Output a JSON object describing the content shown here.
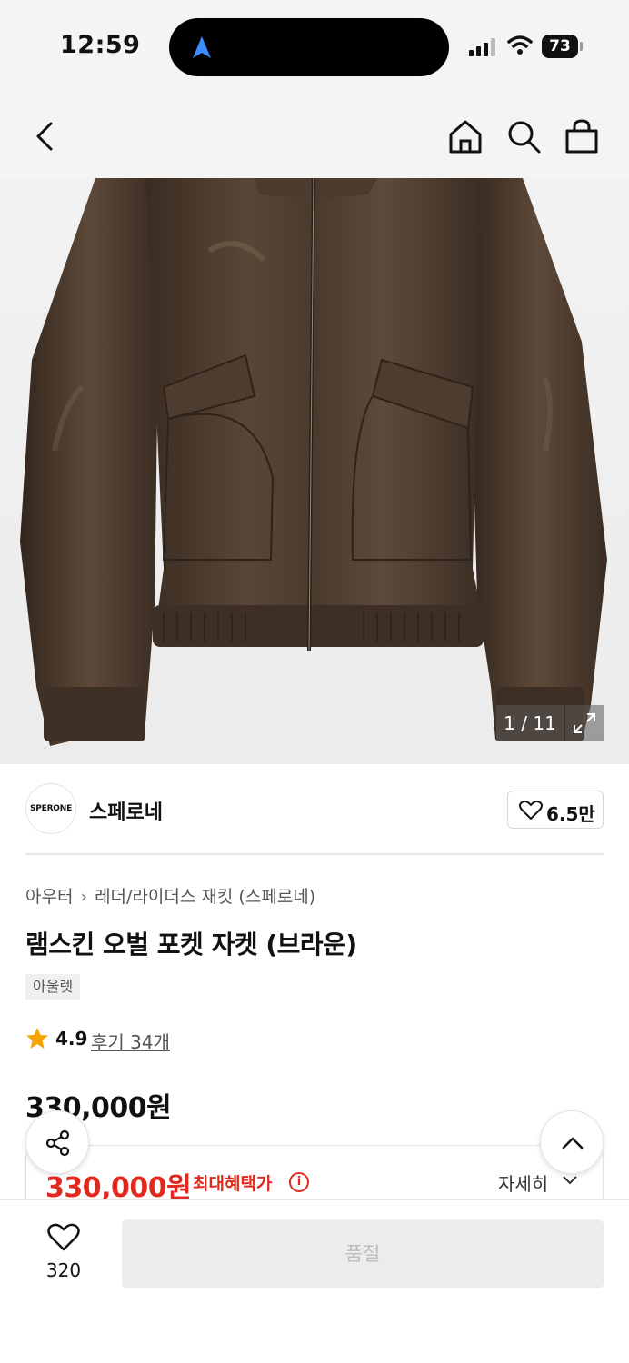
{
  "status_bar": {
    "time": "12:59",
    "battery": "73"
  },
  "nav": {
    "back_icon": "chevron-left-icon",
    "home_icon": "home-icon",
    "search_icon": "search-icon",
    "cart_icon": "shopping-bag-icon"
  },
  "gallery": {
    "counter": "1 / 11",
    "expand_icon": "expand-icon"
  },
  "brand": {
    "logo_text": "SPERONE",
    "name": "스페로네",
    "likes": "6.5만"
  },
  "breadcrumb": {
    "category": "아우터",
    "subcategory": "레더/라이더스 재킷 (스페로네)"
  },
  "product": {
    "title": "램스킨 오벌 포켓 자켓 (브라운)",
    "tag": "아울렛",
    "rating": "4.9",
    "reviews": "후기 34개",
    "price": "330,000원",
    "benefit_price": "330,000원",
    "benefit_label": "최대혜택가",
    "detail_link": "자세히"
  },
  "bottom_bar": {
    "wish_count": "320",
    "soldout_label": "품절"
  },
  "colors": {
    "accent_red": "#e0291f",
    "jacket_brown": "#4a3a2e"
  }
}
